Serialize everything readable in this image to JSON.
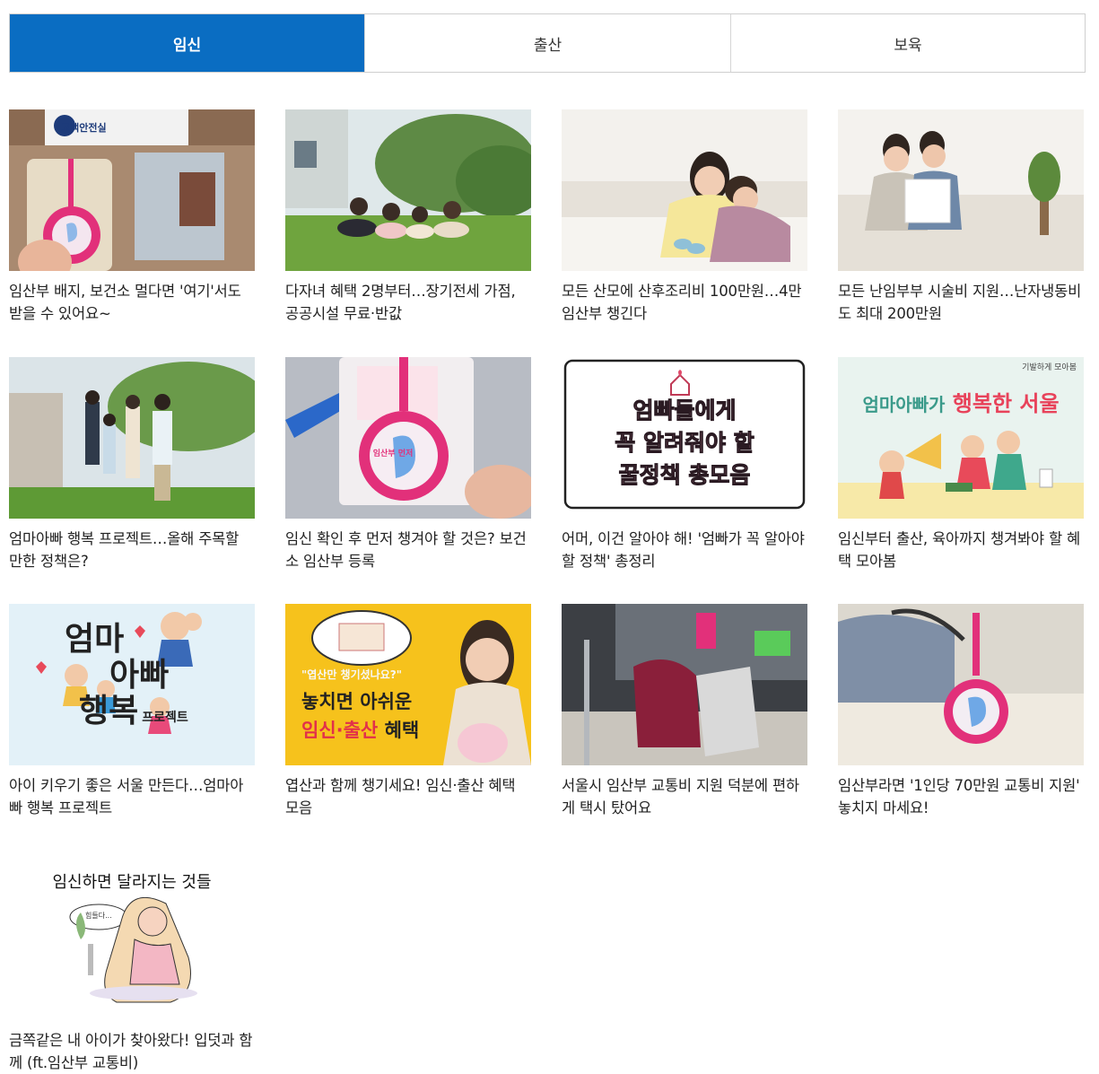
{
  "tabs": [
    {
      "label": "임신",
      "active": true
    },
    {
      "label": "출산",
      "active": false
    },
    {
      "label": "보육",
      "active": false
    }
  ],
  "accent_color": "#0a6dc2",
  "cards": [
    {
      "title": "임산부 배지, 보건소 멀다면 '여기'서도 받을 수 있어요~",
      "image_text": "고객안전실"
    },
    {
      "title": "다자녀 혜택 2명부터…장기전세 가점, 공공시설 무료·반값"
    },
    {
      "title": "모든 산모에 산후조리비 100만원…4만 임산부 챙긴다"
    },
    {
      "title": "모든 난임부부 시술비 지원…난자냉동비도 최대 200만원"
    },
    {
      "title": "엄마아빠 행복 프로젝트…올해 주목할 만한 정책은?"
    },
    {
      "title": "임신 확인 후 먼저 챙겨야 할 것은? 보건소 임산부 등록",
      "image_text": "임산부 먼저"
    },
    {
      "title": "어머, 이건 알아야 해! '엄빠가 꼭 알아야 할 정책' 총정리",
      "image_lines": [
        "엄빠들에게",
        "꼭 알려줘야 할",
        "꿀정책 총모음"
      ]
    },
    {
      "title": "임신부터 출산, 육아까지 챙겨봐야 할 혜택 모아봄",
      "image_lines": [
        "엄마아빠가",
        "행복한 서울"
      ],
      "image_tag": "기발하게 모아봄"
    },
    {
      "title": "아이 키우기 좋은 서울 만든다…엄마아빠 행복 프로젝트",
      "image_lines": [
        "엄마",
        "아빠",
        "행복",
        "프로젝트"
      ]
    },
    {
      "title": "엽산과 함께 챙기세요! 임신·출산 혜택 모음",
      "image_lines": [
        "\"엽산만 챙기셨나요?\"",
        "놓치면 아쉬운",
        "임신·출산",
        "혜택"
      ]
    },
    {
      "title": "서울시 임산부 교통비 지원 덕분에 편하게 택시 탔어요"
    },
    {
      "title": "임산부라면 '1인당 70만원 교통비 지원' 놓치지 마세요!"
    },
    {
      "title": "금쪽같은 내 아이가 찾아왔다! 입덧과 함께 (ft.임산부 교통비)",
      "image_lines": [
        "임신하면 달라지는 것들",
        "힘들다..."
      ]
    }
  ]
}
